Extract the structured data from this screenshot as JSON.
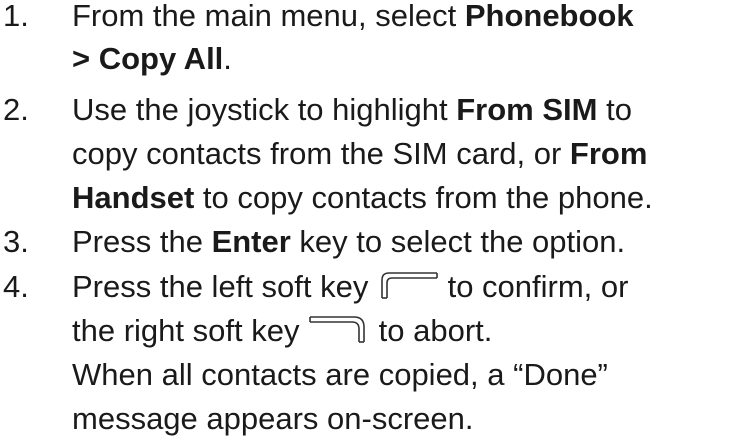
{
  "steps": [
    {
      "number": "1.",
      "l1_a": "From the main menu, select ",
      "l1_b": "Phonebook",
      "l2_a": "> Copy All",
      "l2_b": "."
    },
    {
      "number": "2.",
      "l1_a": "Use the joystick to highlight ",
      "l1_b": "From SIM",
      "l1_c": " to",
      "l2_a": "copy contacts from the SIM card, or ",
      "l2_b": "From",
      "l3_a": "Handset",
      "l3_b": " to copy contacts from the phone."
    },
    {
      "number": "3.",
      "l1_a": "Press the ",
      "l1_b": "Enter",
      "l1_c": " key to select the option."
    },
    {
      "number": "4.",
      "l1_a": "Press the left soft key ",
      "l1_c": " to confirm, or",
      "l2_a": "the right soft key ",
      "l2_c": " to abort.",
      "l3": "When all contacts are copied, a “Done”",
      "l4": "message appears on-screen.",
      "left_icon": "left-soft-key-icon",
      "right_icon": "right-soft-key-icon"
    }
  ]
}
